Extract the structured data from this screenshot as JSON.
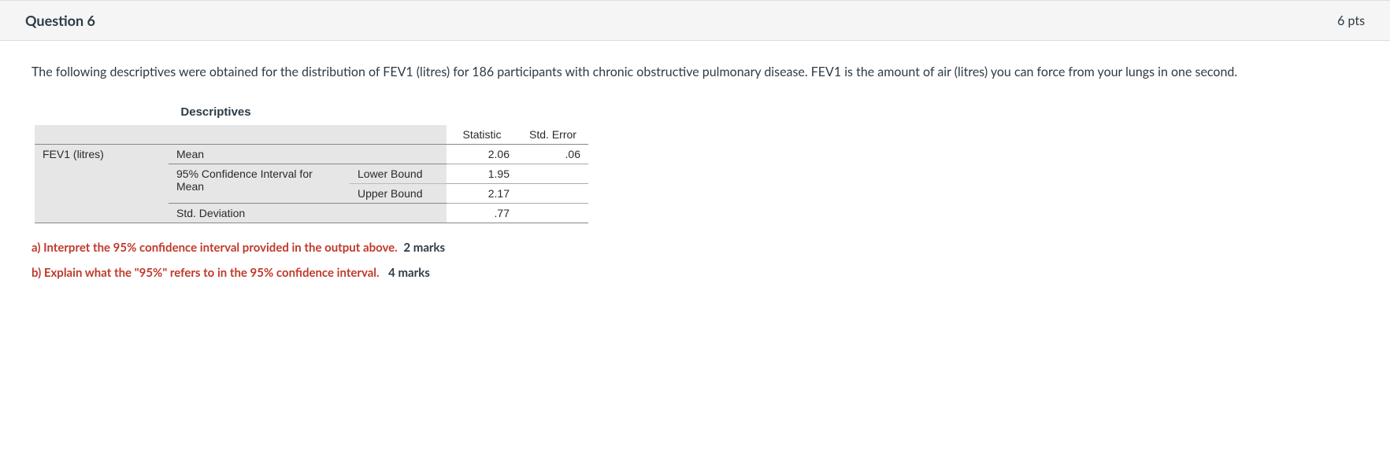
{
  "header": {
    "title": "Question 6",
    "points": "6 pts"
  },
  "prompt": "The following descriptives were obtained for the distribution of FEV1 (litres) for 186 participants with chronic obstructive pulmonary disease.  FEV1 is the amount of air (litres) you can force from your lungs in one second.",
  "table": {
    "title": "Descriptives",
    "cols": {
      "statistic": "Statistic",
      "stderr": "Std. Error"
    },
    "variable": "FEV1 (litres)",
    "rows": {
      "mean": {
        "label": "Mean",
        "stat": "2.06",
        "err": ".06"
      },
      "ci_label": "95% Confidence Interval for Mean",
      "lower": {
        "label": "Lower Bound",
        "stat": "1.95"
      },
      "upper": {
        "label": "Upper Bound",
        "stat": "2.17"
      },
      "sd": {
        "label": "Std. Deviation",
        "stat": ".77"
      }
    }
  },
  "subquestions": {
    "a": {
      "text": "a) Interpret the 95% confidence interval provided in the output above.",
      "marks": "2 marks"
    },
    "b": {
      "text": "b) Explain what the \"95%\" refers to in the 95% confidence interval.",
      "marks": "4 marks"
    }
  }
}
